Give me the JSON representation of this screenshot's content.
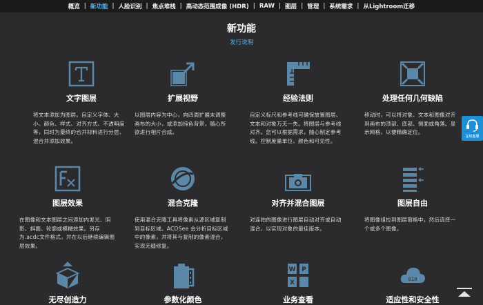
{
  "nav": {
    "items": [
      "概览",
      "新功能",
      "人脸识别",
      "焦点堆栈",
      "高动态范围成像 (HDR)",
      "RAW",
      "图层",
      "管理",
      "系统需求",
      "从Lightroom迁移"
    ],
    "active_index": 1,
    "separator": "|"
  },
  "header": {
    "title": "新功能",
    "release_notes_link": "发行说明"
  },
  "features": [
    {
      "icon": "text-icon",
      "title": "文字图层",
      "desc": "将文本添加为图层。自定义字体、大小、颜色、样式、对齐方式、不透明度等，同时为最终的合并材料进行分层、混合并添加效果。"
    },
    {
      "icon": "expand-icon",
      "title": "扩展视野",
      "desc": "以图层内容为中心，向四周扩展未调整画布的大小，或添加纯色背景，随心所欲进行相片合成。"
    },
    {
      "icon": "ruler-icon",
      "title": "经验法则",
      "desc": "自定义标尺和参考线可确保放置图层、文本和对象万无一失。将图层与参考线对齐。您可以根据需求，随心制定参考线。控制度量单位、颜色和可见性。"
    },
    {
      "icon": "distortion-icon",
      "title": "处理任何几何缺陷",
      "desc": "移动时，可以将对象、文本和图像对齐到画布的顶部、底部、侧面或角落。显示网格，以便精确定位。"
    },
    {
      "icon": "fx-icon",
      "title": "图层效果",
      "desc": "在图像和文本图层之间添加内发光、阴影、斜面、轮廓或模糊效果。另存为.acdc文件格式，并在以后继续编辑图层效果。"
    },
    {
      "icon": "blend-clone-icon",
      "title": "混合克隆",
      "desc": "使用混合克隆工具将像素从源区域复制到目标区域。ACDSee 会分析目标区域中的像素，并将其与复制的像素混合，实现无缝修复。"
    },
    {
      "icon": "align-camera-icon",
      "title": "对齐并混合图层",
      "desc": "对连拍的图像进行图层自动对齐或自动混合，以实现对象的最佳版本。"
    },
    {
      "icon": "layers-list-icon",
      "title": "图层自由",
      "desc": "将图像组拉到图层窗格中，然后选择一个或多个图像。"
    },
    {
      "icon": "box-upload-icon",
      "title": "无尽创造力",
      "desc": ""
    },
    {
      "icon": "film-icon",
      "title": "参数化颜色",
      "desc": ""
    },
    {
      "icon": "office-docs-icon",
      "title": "业务查看",
      "desc": ""
    },
    {
      "icon": "cloud-icon",
      "title": "适应性和安全性",
      "desc": ""
    }
  ],
  "support": {
    "label": "在线客服",
    "icon": "headset-icon"
  },
  "scroll_top": {
    "icon": "scroll-top-icon"
  },
  "colors": {
    "background": "#2b2b2d",
    "accent": "#4fb0e8",
    "icon": "#5b87a8",
    "support": "#1e90d8"
  }
}
